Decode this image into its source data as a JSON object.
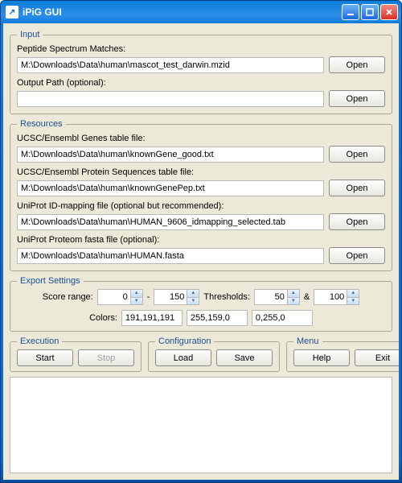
{
  "window": {
    "title": "iPiG GUI",
    "app_icon_glyph": "↗"
  },
  "input": {
    "legend": "Input",
    "psm_label": "Peptide Spectrum Matches:",
    "psm_value": "M:\\Downloads\\Data\\human\\mascot_test_darwin.mzid",
    "output_label": "Output Path (optional):",
    "output_value": "",
    "open_label": "Open"
  },
  "resources": {
    "legend": "Resources",
    "open_label": "Open",
    "genes_label": "UCSC/Ensembl Genes table file:",
    "genes_value": "M:\\Downloads\\Data\\human\\knownGene_good.txt",
    "protein_label": "UCSC/Ensembl Protein Sequences table file:",
    "protein_value": "M:\\Downloads\\Data\\human\\knownGenePep.txt",
    "uniprot_id_label": "UniProt ID-mapping file  (optional but recommended):",
    "uniprot_id_value": "M:\\Downloads\\Data\\human\\HUMAN_9606_idmapping_selected.tab",
    "uniprot_fasta_label": "UniProt Proteom fasta file  (optional):",
    "uniprot_fasta_value": "M:\\Downloads\\Data\\human\\HUMAN.fasta"
  },
  "export": {
    "legend": "Export Settings",
    "score_label": "Score range:",
    "score_min": "0",
    "score_max": "150",
    "dash": "-",
    "thresholds_label": "Thresholds:",
    "threshold_a": "50",
    "amp": "&",
    "threshold_b": "100",
    "colors_label": "Colors:",
    "color1": "191,191,191",
    "color2": "255,159,0",
    "color3": "0,255,0"
  },
  "execution": {
    "legend": "Execution",
    "start": "Start",
    "stop": "Stop"
  },
  "config": {
    "legend": "Configuration",
    "load": "Load",
    "save": "Save"
  },
  "menu": {
    "legend": "Menu",
    "help": "Help",
    "exit": "Exit"
  }
}
